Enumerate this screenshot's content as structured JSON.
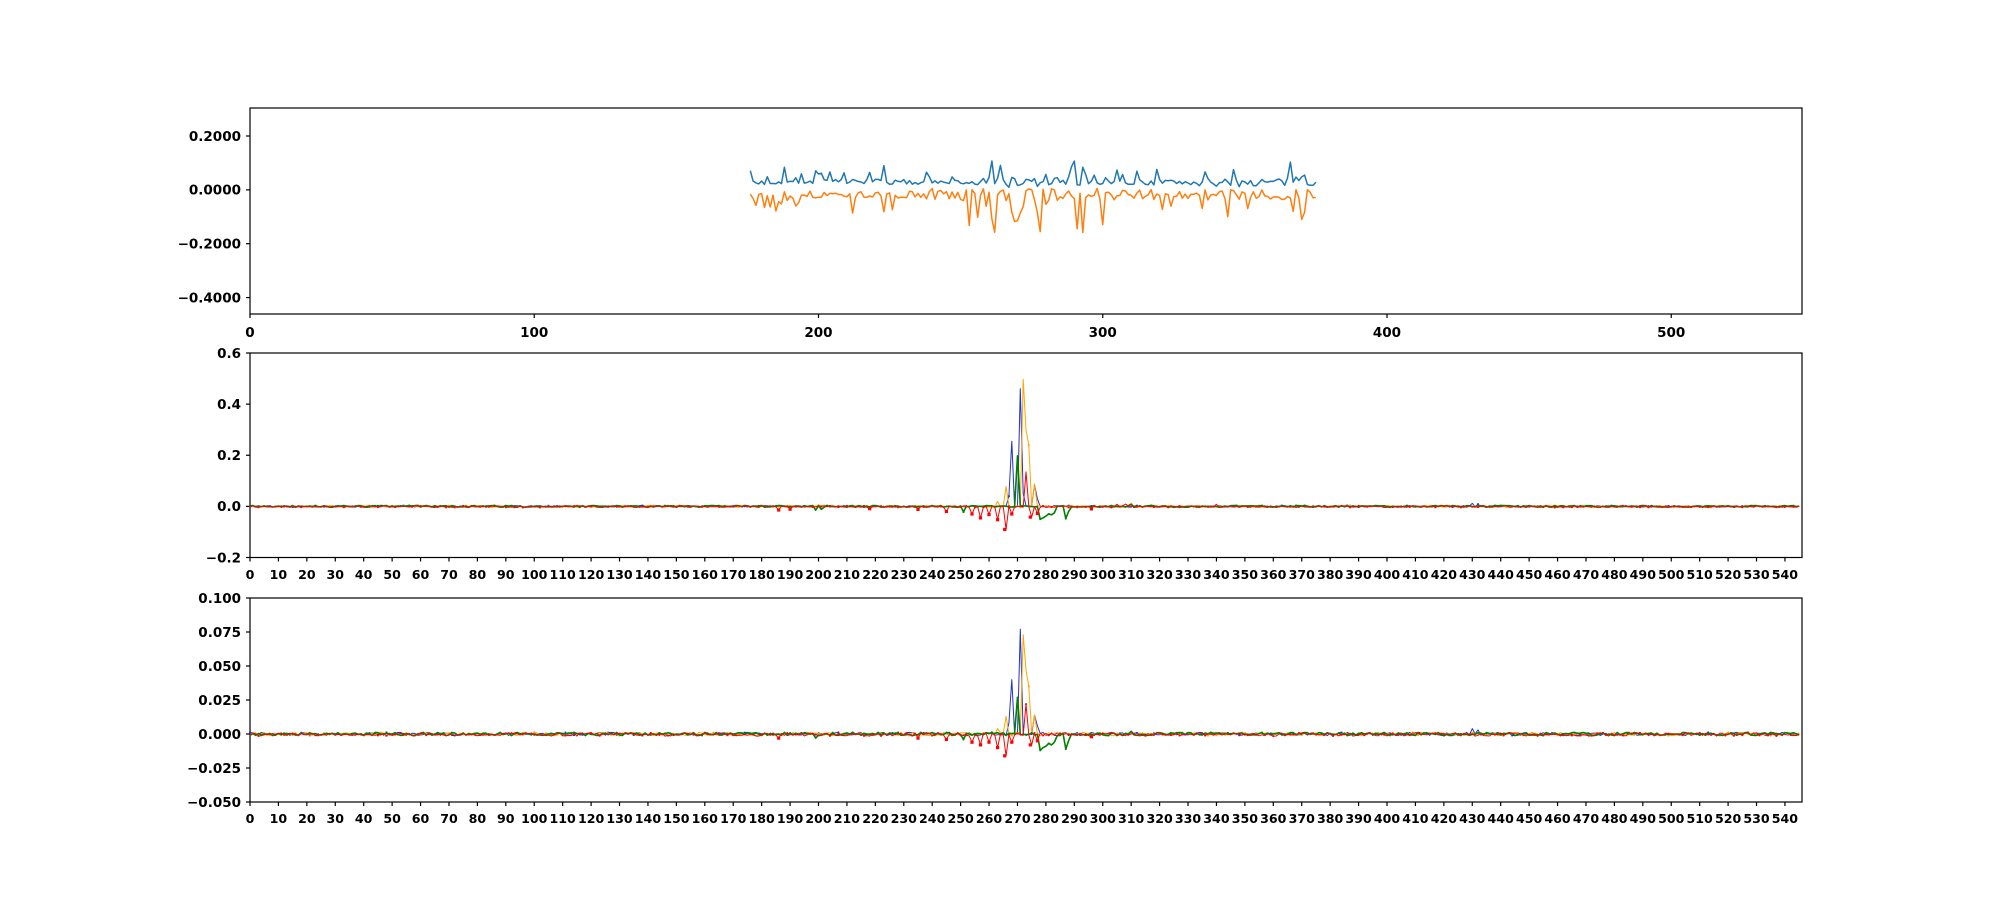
{
  "figure": {
    "background": "#ffffff",
    "description": "Three stacked matplotlib-style subplots: top shows two noisy line traces (blue/orange) spanning x≈176–375; middle and bottom show four-channel near-zero signals with a sharp multi-channel spike cluster around x≈265–285.",
    "spine_color": "#000000"
  },
  "chart_data": [
    {
      "id": "top",
      "type": "line",
      "title": "",
      "xlabel": "",
      "ylabel": "",
      "xlim": [
        0,
        546
      ],
      "ylim": [
        -0.461,
        0.304
      ],
      "grid": false,
      "legend": null,
      "xtick_values": [
        0,
        100,
        200,
        300,
        400,
        500
      ],
      "xtick_labels": [
        "0",
        "100",
        "200",
        "300",
        "400",
        "500"
      ],
      "ytick_values": [
        0.2,
        0.0,
        -0.2,
        -0.4
      ],
      "ytick_labels": [
        "0.2000",
        "0.0000",
        "-0.2000",
        "-0.4000"
      ],
      "series": [
        {
          "name": "line-blue",
          "color": "#1f77b4",
          "x_start": 176,
          "x_end": 375,
          "n": 200,
          "mean": 0.028,
          "noise_amp": 0.011,
          "spike_sign": 1,
          "spike_amp": 0.055,
          "spike_prob": 0.2,
          "regions": [
            {
              "from": 252,
              "to": 295,
              "mult": 1.9
            },
            {
              "from": 330,
              "to": 372,
              "mult": 1.5
            }
          ]
        },
        {
          "name": "line-orange",
          "color": "#ff7f0e",
          "x_start": 176,
          "x_end": 375,
          "n": 200,
          "mean": -0.018,
          "noise_amp": 0.013,
          "spike_sign": -1,
          "spike_amp": 0.075,
          "spike_prob": 0.24,
          "regions": [
            {
              "from": 238,
              "to": 300,
              "mult": 1.8
            },
            {
              "from": 300,
              "to": 372,
              "mult": 1.5
            }
          ]
        }
      ]
    },
    {
      "id": "middle",
      "type": "line",
      "title": "",
      "xlabel": "",
      "ylabel": "",
      "xlim": [
        0,
        546
      ],
      "ylim": [
        -0.2,
        0.6
      ],
      "grid": false,
      "legend": null,
      "xtick_values": [
        0,
        10,
        20,
        30,
        40,
        50,
        60,
        70,
        80,
        90,
        100,
        110,
        120,
        130,
        140,
        150,
        160,
        170,
        180,
        190,
        200,
        210,
        220,
        230,
        240,
        250,
        260,
        270,
        280,
        290,
        300,
        310,
        320,
        330,
        340,
        350,
        360,
        370,
        380,
        390,
        400,
        410,
        420,
        430,
        440,
        450,
        460,
        470,
        480,
        490,
        500,
        510,
        520,
        530,
        540
      ],
      "ytick_values": [
        0.6,
        0.4,
        0.2,
        0.0,
        -0.2
      ],
      "ytick_labels": [
        "0.6",
        "0.4",
        "0.2",
        "0.0",
        "-0.2"
      ],
      "n_points": 546,
      "noise_amp": 0.0035,
      "series": [
        {
          "name": "chan-blue",
          "color": "#2233cc",
          "width": 1.0,
          "spikes": [
            [
              266.5,
              0.04
            ],
            [
              268,
              0.255
            ],
            [
              270.5,
              0.46
            ],
            [
              272,
              0.05
            ],
            [
              276,
              0.085
            ],
            [
              277,
              0.03
            ],
            [
              430,
              0.012
            ],
            [
              432,
              0.009
            ]
          ]
        },
        {
          "name": "chan-orange",
          "color": "#ffa500",
          "width": 1.0,
          "spikes": [
            [
              265.5,
              0.078
            ],
            [
              271.5,
              0.497
            ],
            [
              273,
              0.3
            ],
            [
              274,
              0.24
            ],
            [
              275.5,
              0.088
            ],
            [
              263,
              0.02
            ],
            [
              310,
              0.01
            ]
          ]
        },
        {
          "name": "chan-green",
          "color": "#008000",
          "width": 1.6,
          "spikes": [
            [
              269.5,
              0.198
            ],
            [
              250.5,
              -0.022
            ],
            [
              278,
              -0.05
            ],
            [
              279,
              -0.045
            ],
            [
              280,
              -0.038
            ],
            [
              281,
              -0.03
            ],
            [
              282,
              -0.033
            ],
            [
              283,
              -0.025
            ],
            [
              287,
              -0.048
            ],
            [
              288,
              -0.02
            ],
            [
              199,
              -0.015
            ],
            [
              201,
              -0.012
            ],
            [
              310,
              0.008
            ]
          ]
        },
        {
          "name": "chan-red",
          "color": "#ff0000",
          "width": 1.0,
          "spikes": [
            [
              272.5,
              0.135
            ],
            [
              245,
              -0.02
            ],
            [
              254,
              -0.03
            ],
            [
              257,
              -0.045
            ],
            [
              260,
              -0.032
            ],
            [
              263,
              -0.052
            ],
            [
              265.5,
              -0.09
            ],
            [
              268,
              -0.03
            ],
            [
              274.5,
              -0.042
            ],
            [
              277,
              -0.028
            ],
            [
              186,
              -0.014
            ],
            [
              190,
              -0.011
            ],
            [
              218,
              -0.009
            ],
            [
              235,
              -0.012
            ],
            [
              296,
              -0.01
            ],
            [
              305,
              0.008
            ],
            [
              308,
              0.009
            ],
            [
              340,
              0.008
            ]
          ]
        }
      ]
    },
    {
      "id": "bottom",
      "type": "line",
      "title": "",
      "xlabel": "",
      "ylabel": "",
      "xlim": [
        0,
        546
      ],
      "ylim": [
        -0.05,
        0.1
      ],
      "grid": false,
      "legend": null,
      "xtick_values": [
        0,
        10,
        20,
        30,
        40,
        50,
        60,
        70,
        80,
        90,
        100,
        110,
        120,
        130,
        140,
        150,
        160,
        170,
        180,
        190,
        200,
        210,
        220,
        230,
        240,
        250,
        260,
        270,
        280,
        290,
        300,
        310,
        320,
        330,
        340,
        350,
        360,
        370,
        380,
        390,
        400,
        410,
        420,
        430,
        440,
        450,
        460,
        470,
        480,
        490,
        500,
        510,
        520,
        530,
        540
      ],
      "ytick_values": [
        0.1,
        0.075,
        0.05,
        0.025,
        0.0,
        -0.025,
        -0.05
      ],
      "ytick_labels": [
        "0.100",
        "0.075",
        "0.050",
        "0.025",
        "0.000",
        "-0.025",
        "-0.050"
      ],
      "n_points": 546,
      "noise_amp": 0.0012,
      "series": [
        {
          "name": "chan-blue",
          "color": "#2233cc",
          "width": 1.0,
          "spikes": [
            [
              266.5,
              0.008
            ],
            [
              268,
              0.04
            ],
            [
              270.5,
              0.077
            ],
            [
              276,
              0.014
            ],
            [
              277,
              0.006
            ],
            [
              430,
              0.004
            ],
            [
              432,
              0.003
            ]
          ]
        },
        {
          "name": "chan-orange",
          "color": "#ffa500",
          "width": 1.0,
          "spikes": [
            [
              265.5,
              0.013
            ],
            [
              271.5,
              0.073
            ],
            [
              273,
              0.047
            ],
            [
              274,
              0.035
            ],
            [
              275.5,
              0.014
            ],
            [
              263,
              0.004
            ]
          ]
        },
        {
          "name": "chan-green",
          "color": "#008000",
          "width": 1.6,
          "spikes": [
            [
              269.5,
              0.027
            ],
            [
              250.5,
              -0.004
            ],
            [
              278,
              -0.012
            ],
            [
              279,
              -0.01
            ],
            [
              280,
              -0.009
            ],
            [
              281,
              -0.007
            ],
            [
              282,
              -0.008
            ],
            [
              283,
              -0.006
            ],
            [
              287,
              -0.011
            ],
            [
              288,
              -0.005
            ],
            [
              199,
              -0.003
            ],
            [
              310,
              0.002
            ]
          ]
        },
        {
          "name": "chan-red",
          "color": "#ff0000",
          "width": 1.0,
          "spikes": [
            [
              272.5,
              0.022
            ],
            [
              254,
              -0.006
            ],
            [
              257,
              -0.008
            ],
            [
              260,
              -0.006
            ],
            [
              263,
              -0.01
            ],
            [
              265.5,
              -0.016
            ],
            [
              268,
              -0.006
            ],
            [
              274.5,
              -0.008
            ],
            [
              277,
              -0.005
            ],
            [
              245,
              -0.004
            ],
            [
              186,
              -0.003
            ],
            [
              235,
              -0.003
            ],
            [
              296,
              -0.002
            ]
          ]
        }
      ]
    }
  ]
}
